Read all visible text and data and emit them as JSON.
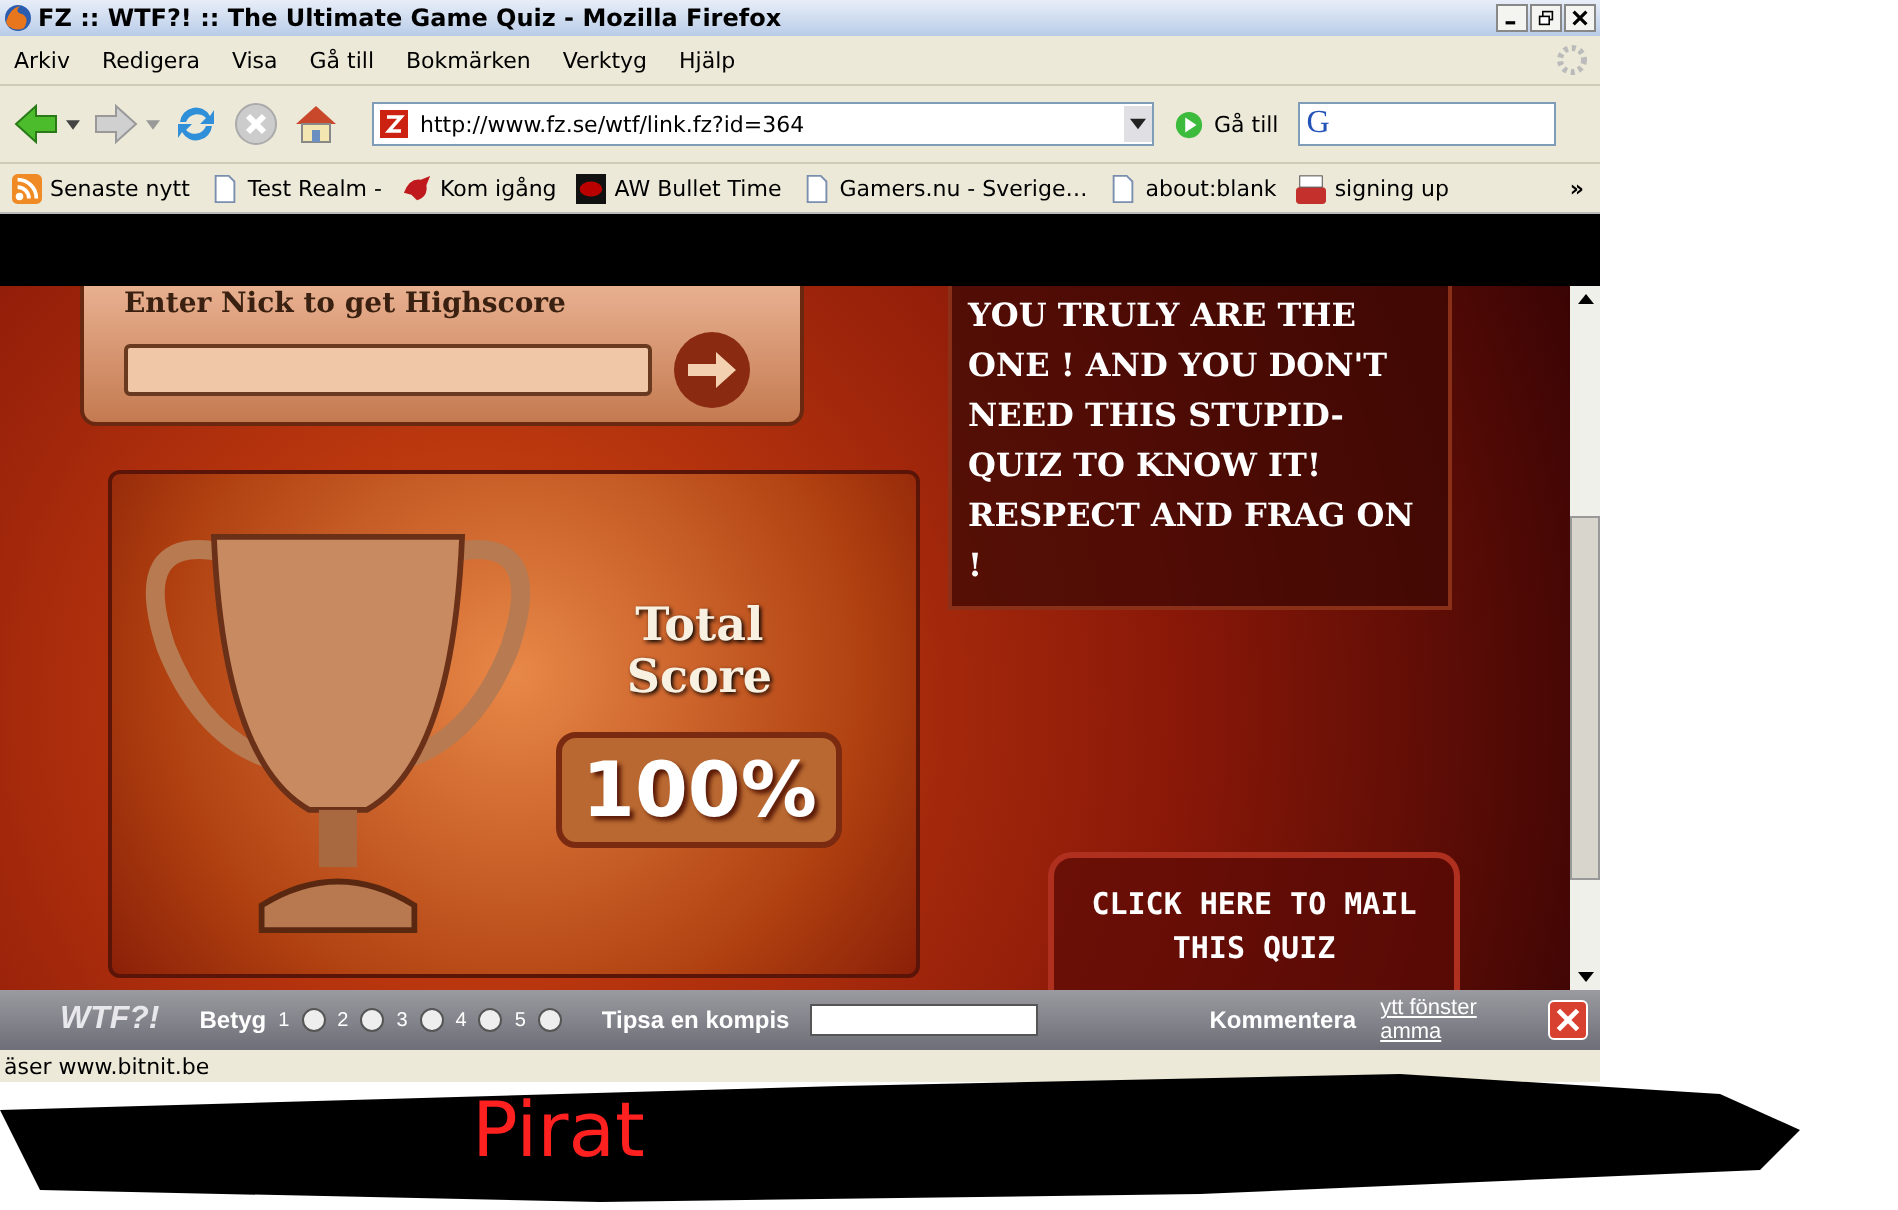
{
  "window": {
    "title": "FZ :: WTF?! :: The Ultimate Game Quiz - Mozilla Firefox"
  },
  "menu": [
    "Arkiv",
    "Redigera",
    "Visa",
    "Gå till",
    "Bokmärken",
    "Verktyg",
    "Hjälp"
  ],
  "address": {
    "value": "http://www.fz.se/wtf/link.fz?id=364"
  },
  "go_button": "Gå till",
  "search_logo": "G",
  "bookmarks_more": "»",
  "bookmarks": [
    {
      "label": "Senaste nytt",
      "kind": "rss"
    },
    {
      "label": "Test Realm -",
      "kind": "page"
    },
    {
      "label": "Kom igång",
      "kind": "creature"
    },
    {
      "label": "AW Bullet Time",
      "kind": "dark"
    },
    {
      "label": "Gamers.nu - Sverige…",
      "kind": "page"
    },
    {
      "label": "about:blank",
      "kind": "page"
    },
    {
      "label": "signing up",
      "kind": "video"
    }
  ],
  "quiz": {
    "nick_prompt": "Enter Nick to get Highscore",
    "message": "YOU TRULY ARE THE ONE ! AND YOU DON'T NEED THIS STUPID-QUIZ TO KNOW IT! RESPECT AND FRAG ON !",
    "score_title": "Total Score",
    "score": "100%",
    "mail_link": "CLICK HERE TO MAIL THIS QUIZ"
  },
  "wtf_bar": {
    "logo": "WTF?!",
    "rating_label": "Betyg",
    "ratings": [
      {
        "label": "1",
        "selected": false
      },
      {
        "label": "2",
        "selected": false
      },
      {
        "label": "3",
        "selected": false
      },
      {
        "label": "4",
        "selected": false
      },
      {
        "label": "5",
        "selected": false
      }
    ],
    "tip_label": "Tipsa en kompis",
    "comment": "Kommentera",
    "new_window": "ytt fönster",
    "same_window": "amma"
  },
  "status": "äser www.bitnit.be",
  "annotation": "Pirat"
}
